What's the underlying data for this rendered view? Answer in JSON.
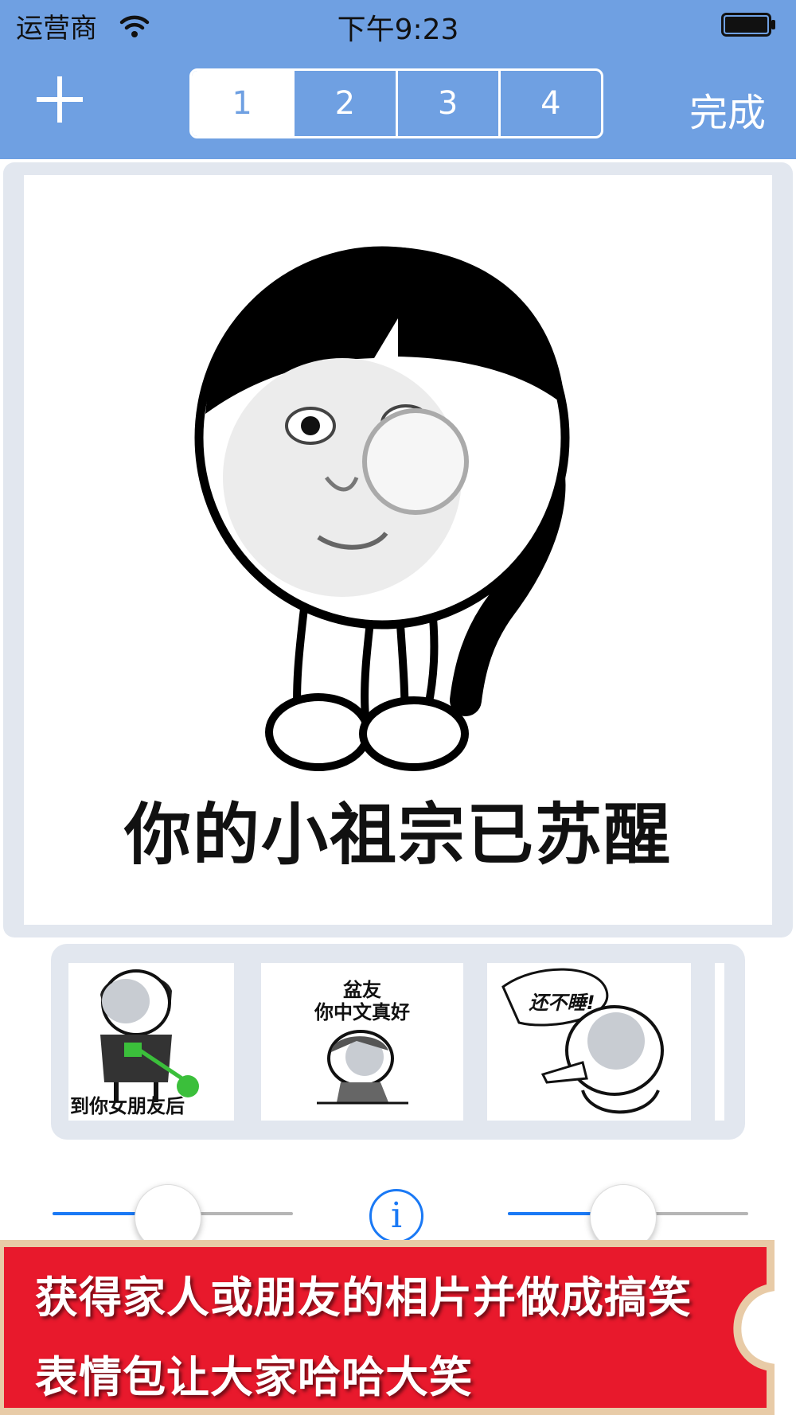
{
  "status_bar": {
    "carrier": "运营商",
    "time": "下午9:23"
  },
  "nav": {
    "segments": [
      "1",
      "2",
      "3",
      "4"
    ],
    "selected_segment": "1",
    "done_label": "完成"
  },
  "main_image": {
    "caption": "你的小祖宗已苏醒"
  },
  "thumbnails": [
    {
      "caption": "到你女朋友后"
    },
    {
      "caption_line1": "盆友",
      "caption_line2": "你中文真好"
    },
    {
      "caption": "还不睡!"
    },
    {
      "caption": ""
    }
  ],
  "sliders": [
    {
      "value_fraction": 0.48
    },
    {
      "value_fraction": 0.48
    }
  ],
  "info_glyph": "i",
  "banner": {
    "line1": "获得家人或朋友的相片并做成搞笑",
    "line2": "表情包让大家哈哈大笑"
  },
  "colors": {
    "nav_bar": "#6fa0e2",
    "panel": "#e2e7ef",
    "slider_fill": "#1a79f5",
    "banner_red": "#e8192c",
    "banner_border": "#e8cba7"
  },
  "icons": [
    "wifi-icon",
    "battery-icon",
    "plus-icon",
    "info-icon"
  ]
}
